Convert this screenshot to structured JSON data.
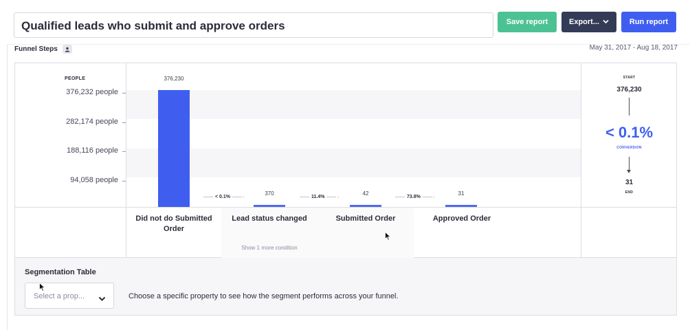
{
  "header": {
    "report_title": "Qualified leads who submit and approve orders",
    "save_label": "Save report",
    "export_label": "Export...",
    "run_label": "Run report",
    "colors": {
      "save": "#4cc294",
      "export": "#343b57",
      "run": "#3f5ef0"
    }
  },
  "toolbar": {
    "funnel_steps_label": "Funnel Steps",
    "date_range": "May 31, 2017 - Aug 18, 2017"
  },
  "chart": {
    "y_axis_label": "PEOPLE",
    "y_ticks": [
      "376,232 people",
      "282,174 people",
      "188,116 people",
      "94,058 people"
    ],
    "bar_labels": [
      "376,230",
      "370",
      "42",
      "31"
    ],
    "conversions": [
      "< 0.1%",
      "11.4%",
      "73.8%"
    ],
    "steps": [
      "Did not do Submitted Order",
      "Lead status changed",
      "Submitted Order",
      "Approved Order"
    ],
    "show_more": "Show 1 more condition",
    "accent": "#3f5ef0"
  },
  "chart_data": {
    "type": "bar",
    "categories": [
      "Did not do Submitted Order",
      "Lead status changed",
      "Submitted Order",
      "Approved Order"
    ],
    "values": [
      376230,
      370,
      42,
      31
    ],
    "title": "",
    "xlabel": "",
    "ylabel": "PEOPLE",
    "ylim": [
      0,
      376232
    ],
    "y_ticks": [
      94058,
      188116,
      282174,
      376232
    ],
    "step_conversions": [
      "< 0.1%",
      "11.4%",
      "73.8%"
    ]
  },
  "summary": {
    "start_label": "START",
    "start_value": "376,230",
    "conversion_value": "< 0.1%",
    "conversion_label": "CONVERSION",
    "end_value": "31",
    "end_label": "END"
  },
  "segmentation": {
    "title": "Segmentation Table",
    "select_placeholder": "Select a prop...",
    "hint": "Choose a specific property to see how the segment performs across your funnel."
  }
}
